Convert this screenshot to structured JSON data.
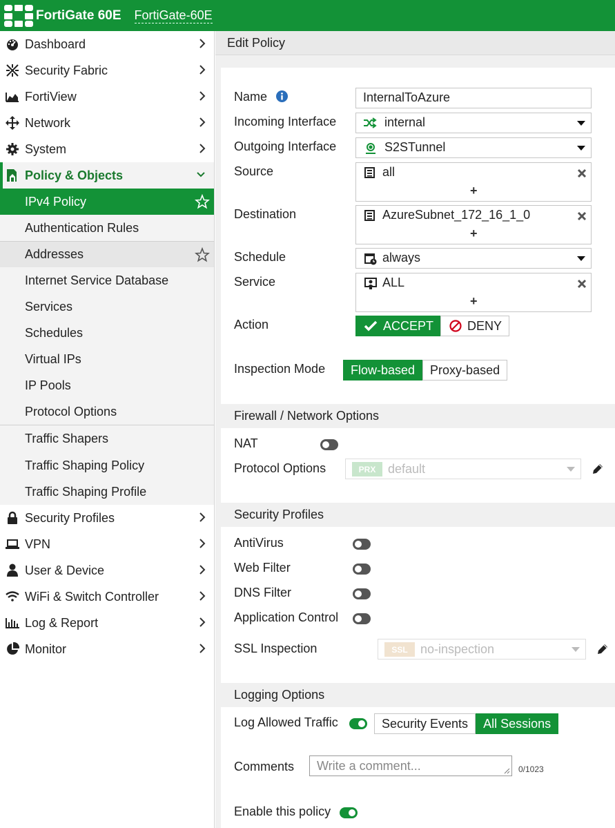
{
  "header": {
    "brand": "FortiGate 60E",
    "hostname": "FortiGate-60E",
    "color": "#139237"
  },
  "sidebar": {
    "items": [
      {
        "label": "Dashboard",
        "icon": "dashboard-icon"
      },
      {
        "label": "Security Fabric",
        "icon": "fabric-icon"
      },
      {
        "label": "FortiView",
        "icon": "chart-icon"
      },
      {
        "label": "Network",
        "icon": "network-icon"
      },
      {
        "label": "System",
        "icon": "gear-icon"
      },
      {
        "label": "Policy & Objects",
        "icon": "policy-icon"
      }
    ],
    "policy_sub": [
      "IPv4 Policy",
      "Authentication Rules",
      "Addresses",
      "Internet Service Database",
      "Services",
      "Schedules",
      "Virtual IPs",
      "IP Pools",
      "Protocol Options",
      "Traffic Shapers",
      "Traffic Shaping Policy",
      "Traffic Shaping Profile"
    ],
    "items_after": [
      {
        "label": "Security Profiles",
        "icon": "lock-icon"
      },
      {
        "label": "VPN",
        "icon": "laptop-icon"
      },
      {
        "label": "User & Device",
        "icon": "user-icon"
      },
      {
        "label": "WiFi & Switch Controller",
        "icon": "wifi-icon"
      },
      {
        "label": "Log & Report",
        "icon": "bar-chart-icon"
      },
      {
        "label": "Monitor",
        "icon": "pie-icon"
      }
    ]
  },
  "main": {
    "title": "Edit Policy",
    "form": {
      "name_label": "Name",
      "name_value": "InternalToAzure",
      "incoming_label": "Incoming Interface",
      "incoming_value": "internal",
      "outgoing_label": "Outgoing Interface",
      "outgoing_value": "S2STunnel",
      "source_label": "Source",
      "source_value": "all",
      "destination_label": "Destination",
      "destination_value": "AzureSubnet_172_16_1_0",
      "schedule_label": "Schedule",
      "schedule_value": "always",
      "service_label": "Service",
      "service_value": "ALL",
      "action_label": "Action",
      "accept_label": "ACCEPT",
      "deny_label": "DENY",
      "inspection_label": "Inspection Mode",
      "flow_label": "Flow-based",
      "proxy_label": "Proxy-based",
      "plus": "+"
    },
    "firewall": {
      "title": "Firewall / Network Options",
      "nat_label": "NAT",
      "nat_on": false,
      "protocol_label": "Protocol Options",
      "protocol_badge": "PRX",
      "protocol_value": "default"
    },
    "security": {
      "title": "Security Profiles",
      "antivirus_label": "AntiVirus",
      "webfilter_label": "Web Filter",
      "dnsfilter_label": "DNS Filter",
      "appcontrol_label": "Application Control",
      "ssl_label": "SSL Inspection",
      "ssl_badge": "SSL",
      "ssl_value": "no-inspection"
    },
    "logging": {
      "title": "Logging Options",
      "log_label": "Log Allowed Traffic",
      "log_on": true,
      "security_events": "Security Events",
      "all_sessions": "All Sessions",
      "comments_label": "Comments",
      "comments_placeholder": "Write a comment...",
      "counter": "0/1023",
      "enable_label": "Enable this policy",
      "enable_on": true
    }
  }
}
